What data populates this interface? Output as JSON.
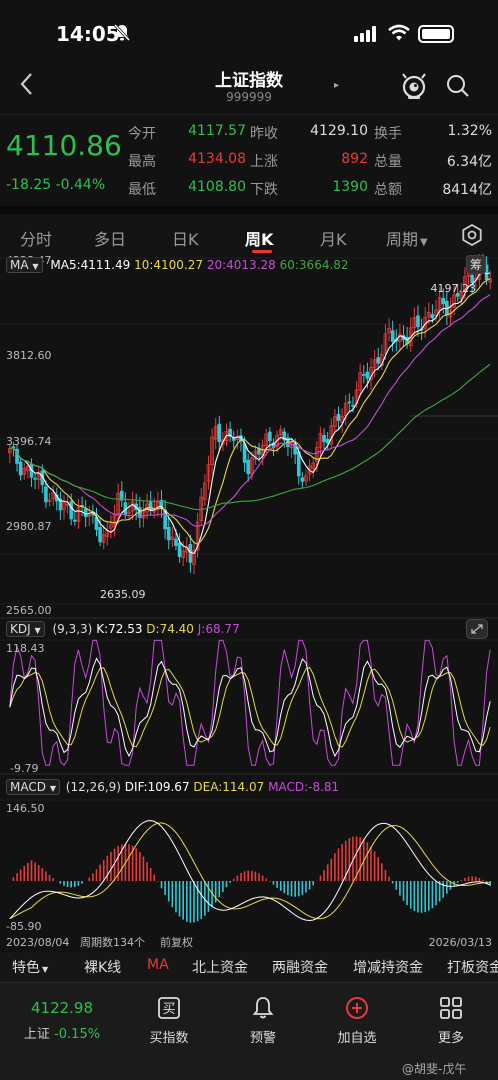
{
  "status": {
    "time": "14:05"
  },
  "nav": {
    "title": "上证指数",
    "code": "999999"
  },
  "quote": {
    "price": "4110.86",
    "change": "-18.25",
    "change_pct": "-0.44%",
    "rows": [
      [
        {
          "label": "今开",
          "value": "4117.57",
          "color": "green"
        },
        {
          "label": "昨收",
          "value": "4129.10",
          "color": "white"
        },
        {
          "label": "换手",
          "value": "1.32%",
          "color": "white"
        }
      ],
      [
        {
          "label": "最高",
          "value": "4134.08",
          "color": "red"
        },
        {
          "label": "上涨",
          "value": "892",
          "color": "red"
        },
        {
          "label": "总量",
          "value": "6.34亿",
          "color": "white"
        }
      ],
      [
        {
          "label": "最低",
          "value": "4108.80",
          "color": "green"
        },
        {
          "label": "下跌",
          "value": "1390",
          "color": "green"
        },
        {
          "label": "总额",
          "value": "8414亿",
          "color": "white"
        }
      ]
    ]
  },
  "tabs": [
    "分时",
    "多日",
    "日K",
    "周K",
    "月K",
    "周期"
  ],
  "active_tab": "周K",
  "main_chart": {
    "indicator": "MA",
    "ma5": "MA5:4111.49",
    "ma10": "10:4100.27",
    "ma20": "20:4013.28",
    "ma60": "60:3664.82",
    "chip_label": "筹",
    "y_labels": [
      "4228.47",
      "3812.60",
      "3396.74",
      "2980.87",
      "2565.00"
    ],
    "high_label": "4197.23",
    "low_label": "2635.09",
    "colors": {
      "up": "#e83a3a",
      "down": "#33c6d6",
      "ma5": "#ffffff",
      "ma10": "#e5d94a",
      "ma20": "#c64cd9",
      "ma60": "#3ea83e"
    }
  },
  "kdj": {
    "label": "KDJ",
    "params": "(9,3,3)",
    "k": "K:72.53",
    "d": "D:74.40",
    "j": "J:68.77",
    "y_top": "118.43",
    "y_bottom": "-9.79"
  },
  "macd": {
    "label": "MACD",
    "params": "(12,26,9)",
    "dif": "DIF:109.67",
    "dea": "DEA:114.07",
    "macd": "MACD:-8.81",
    "y_top": "146.50",
    "y_bottom": "-85.90",
    "date_start": "2023/08/04",
    "period_count": "周期数134个",
    "adjust": "前复权",
    "date_end": "2026/03/13"
  },
  "bottom_tabs": [
    "特色",
    "裸K线",
    "MA",
    "北上资金",
    "两融资金",
    "增减持资金",
    "打板资金"
  ],
  "footer": {
    "index_value": "4122.98",
    "index_name": "上证",
    "index_change": "-0.15%",
    "items": [
      "买指数",
      "预警",
      "加自选",
      "更多"
    ]
  },
  "watermark": "@胡斐-戊午"
}
